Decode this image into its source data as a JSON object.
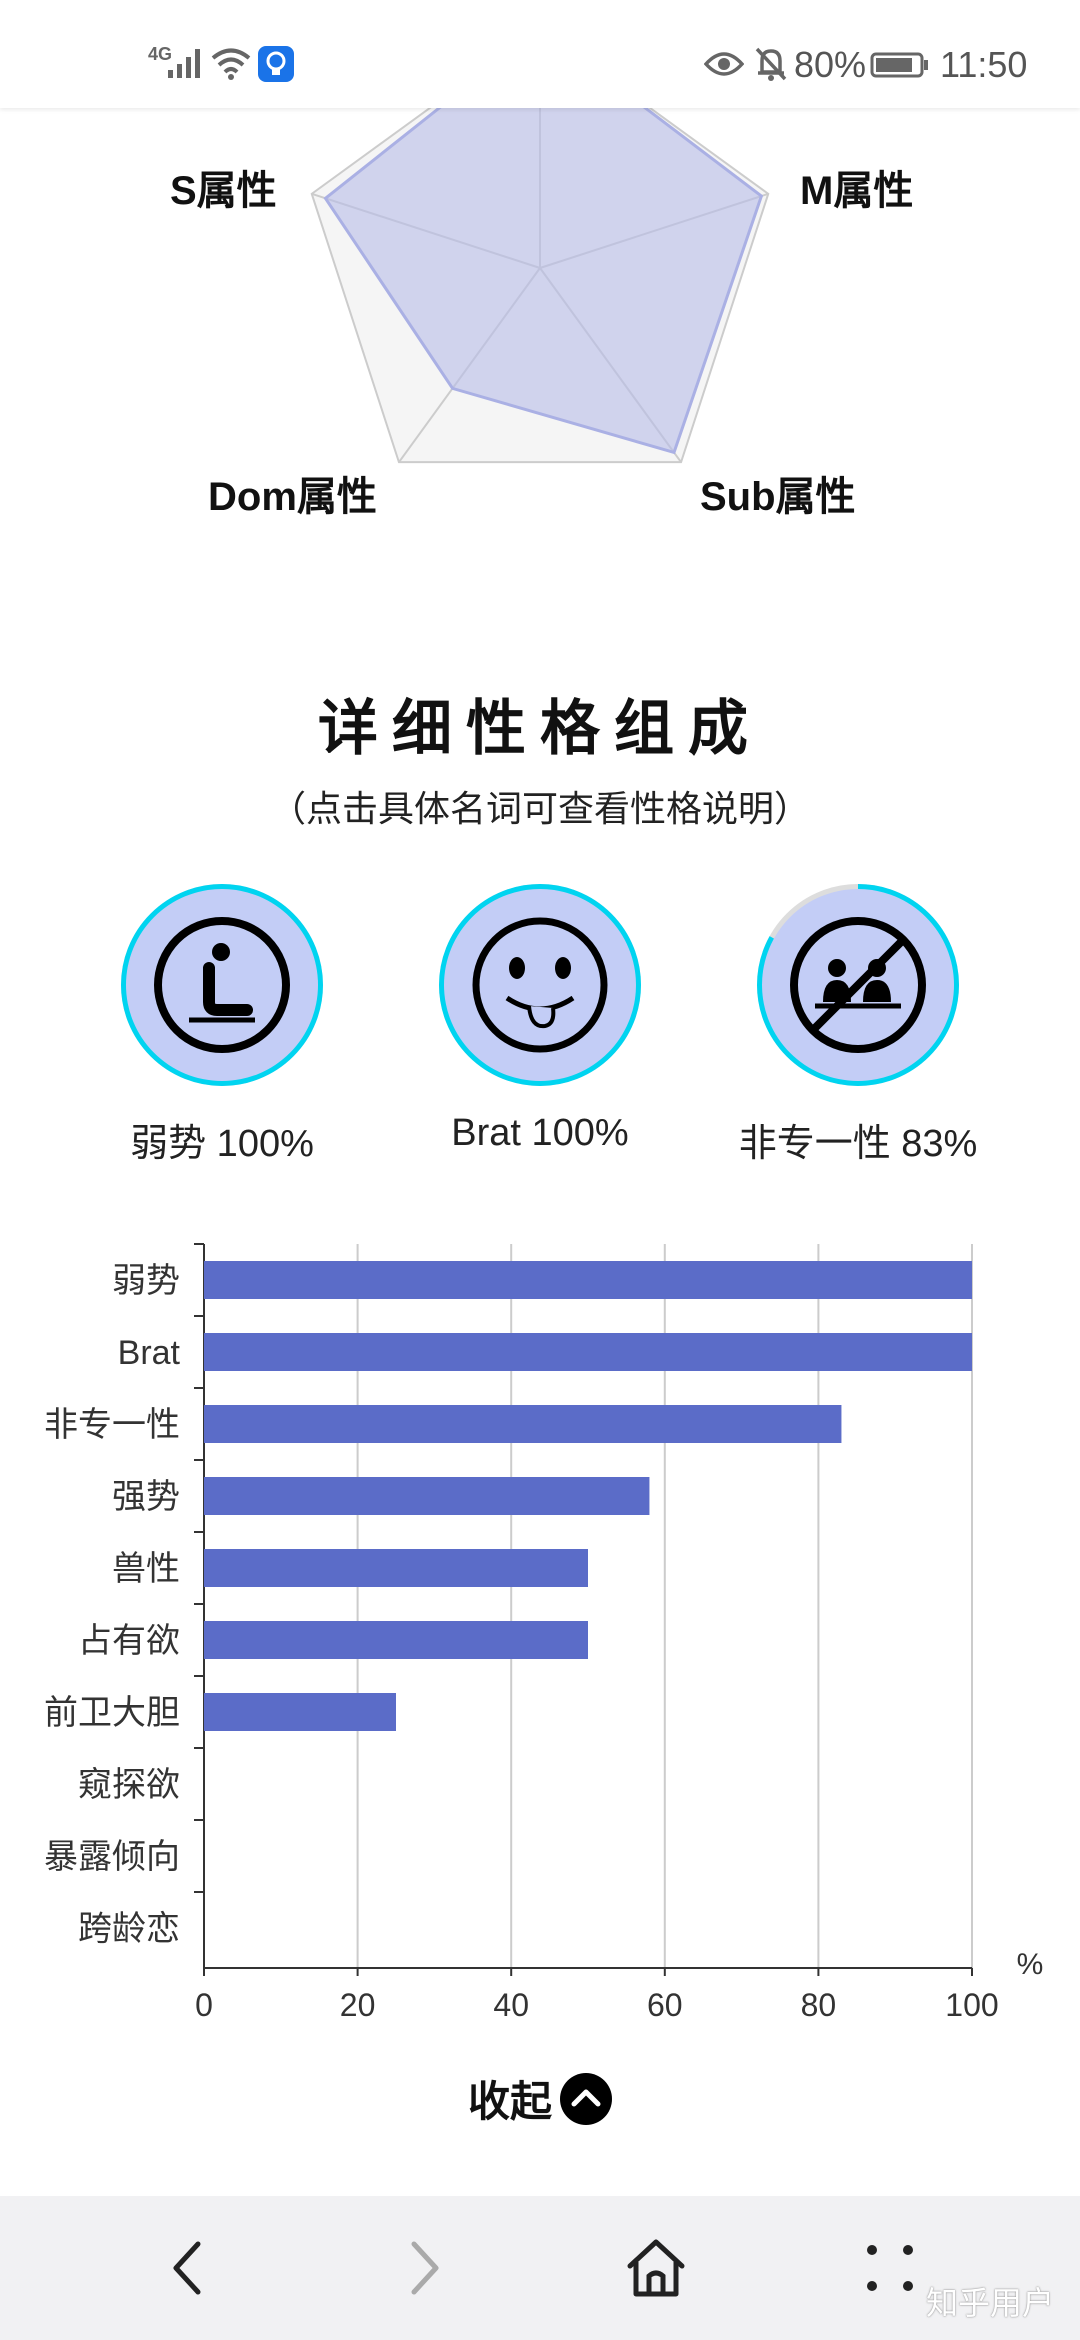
{
  "status_bar": {
    "network": "4G",
    "battery": "80%",
    "time": "11:50",
    "icons": [
      "signal-icon",
      "wifi-icon",
      "lightbulb-icon",
      "eye-icon",
      "mute-bell-icon",
      "battery-icon"
    ]
  },
  "radar": {
    "labels": {
      "s": "S属性",
      "m": "M属性",
      "sub": "Sub属性",
      "dom": "Dom属性"
    }
  },
  "section": {
    "title": "详细性格组成",
    "subtitle": "（点击具体名词可查看性格说明）"
  },
  "traits": [
    {
      "label": "弱势 100%",
      "percent": 100,
      "icon": "kneeling-person-icon"
    },
    {
      "label": "Brat 100%",
      "percent": 100,
      "icon": "tongue-out-face-icon"
    },
    {
      "label": "非专一性 83%",
      "percent": 83,
      "icon": "no-couple-icon"
    }
  ],
  "colors": {
    "bar": "#5b6cc8",
    "ring": "#00d4f0",
    "ring_track": "#dddddd",
    "icon_fill": "#c3cdf6",
    "radar_fill": "#b8bde8"
  },
  "chart_data": {
    "type": "bar",
    "orientation": "horizontal",
    "categories": [
      "弱势",
      "Brat",
      "非专一性",
      "强势",
      "兽性",
      "占有欲",
      "前卫大胆",
      "窥探欲",
      "暴露倾向",
      "跨龄恋"
    ],
    "values": [
      100,
      100,
      83,
      58,
      50,
      50,
      25,
      0,
      0,
      0
    ],
    "xlim": [
      0,
      100
    ],
    "xticks": [
      "0",
      "20",
      "40",
      "60",
      "80",
      "100"
    ],
    "xunit": "%",
    "grid": true
  },
  "collapse": {
    "label": "收起"
  },
  "bottom_nav": {
    "watermark": "知乎用户"
  }
}
